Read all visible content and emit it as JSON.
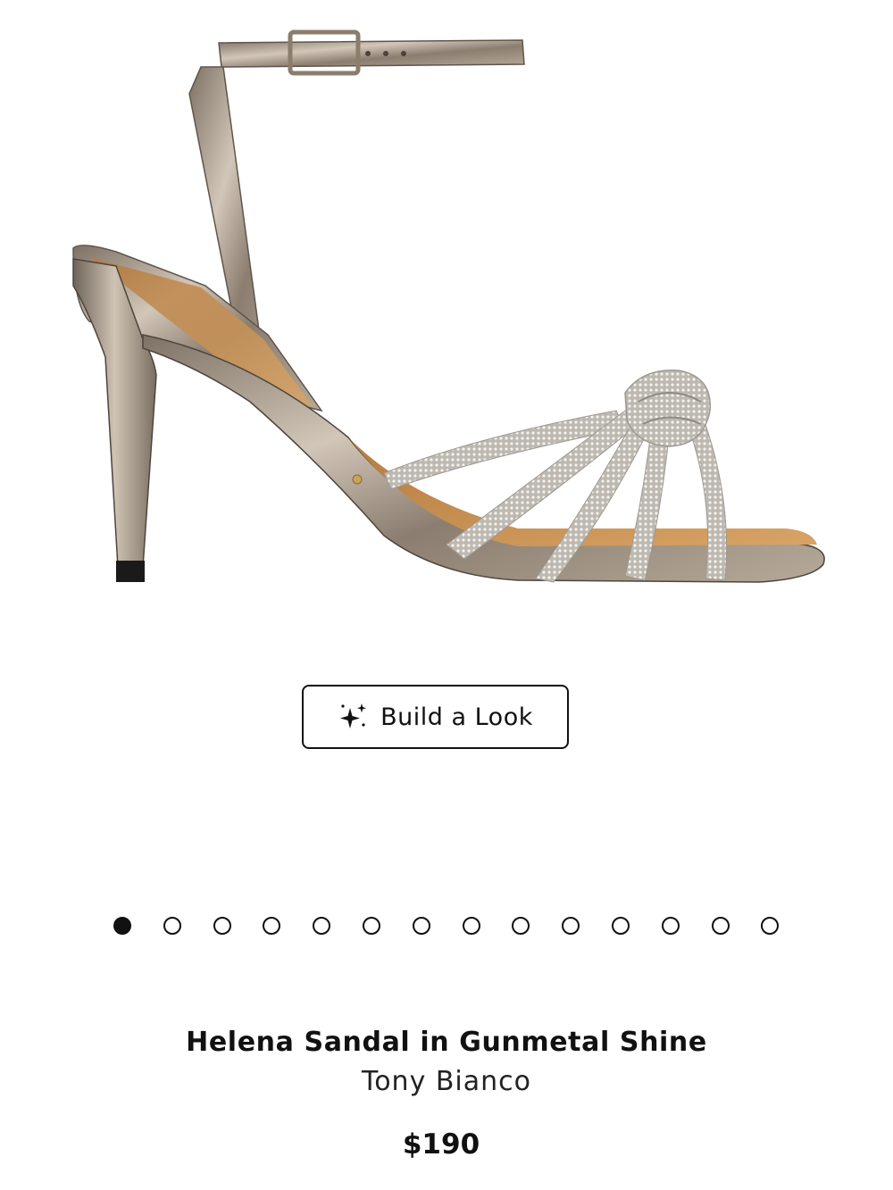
{
  "gallery": {
    "image_alt": "sandal-product-photo",
    "dot_count": 14,
    "active_index": 0
  },
  "build_look": {
    "label": "Build a Look",
    "icon": "sparkles-icon"
  },
  "product": {
    "title": "Helena Sandal in Gunmetal Shine",
    "brand": "Tony Bianco",
    "price": "$190"
  },
  "colors": {
    "text": "#111111",
    "metallic": "#9c8f80",
    "lining": "#c8924f",
    "rhinestone": "#d9d6cf"
  }
}
